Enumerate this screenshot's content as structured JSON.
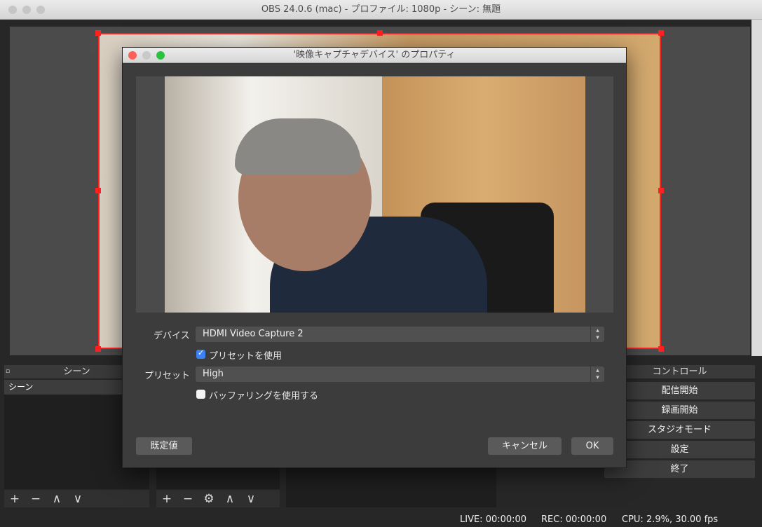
{
  "window": {
    "title": "OBS 24.0.6 (mac) - プロファイル: 1080p - シーン: 無題"
  },
  "docks": {
    "scenes": {
      "title": "シーン",
      "items": [
        "シーン"
      ]
    },
    "controls": {
      "title": "コントロール",
      "buttons": [
        "配信開始",
        "録画開始",
        "スタジオモード",
        "設定",
        "終了"
      ]
    }
  },
  "toolbar": {
    "add": "+",
    "remove": "−",
    "up": "∧",
    "down": "∨",
    "gear": "⚙"
  },
  "status": {
    "live": "LIVE: 00:00:00",
    "rec": "REC: 00:00:00",
    "cpu": "CPU: 2.9%, 30.00 fps"
  },
  "dialog": {
    "title": "'映像キャプチャデバイス' のプロパティ",
    "device_label": "デバイス",
    "device_value": "HDMI Video Capture 2",
    "use_preset_label": "プリセットを使用",
    "use_preset_checked": true,
    "preset_label": "プリセット",
    "preset_value": "High",
    "buffering_label": "バッファリングを使用する",
    "buffering_checked": false,
    "defaults_button": "既定値",
    "cancel_button": "キャンセル",
    "ok_button": "OK"
  },
  "colors": {
    "accent": "#3b82f6",
    "selection": "#ff2020"
  }
}
